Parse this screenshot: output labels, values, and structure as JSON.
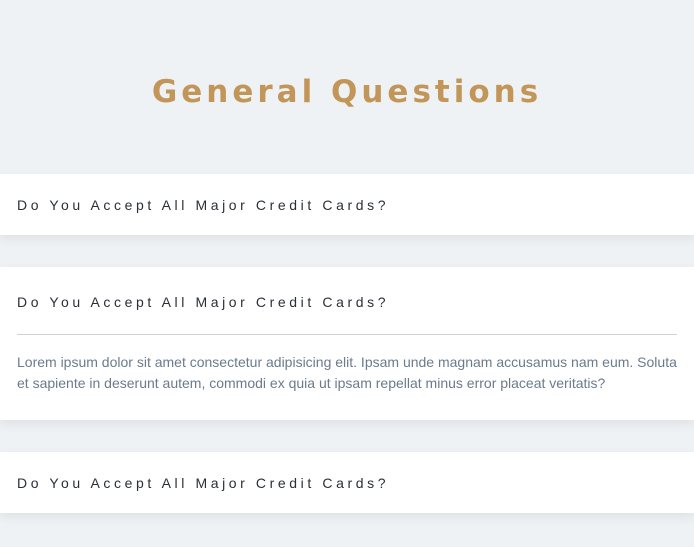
{
  "page": {
    "title": "General Questions"
  },
  "faq": {
    "items": [
      {
        "question": "Do You Accept All Major Credit Cards?",
        "open": false,
        "answer": ""
      },
      {
        "question": "Do You Accept All Major Credit Cards?",
        "open": true,
        "answer": "Lorem ipsum dolor sit amet consectetur adipisicing elit. Ipsam unde magnam accusamus nam eum. Soluta et sapiente in deserunt autem, commodi ex quia ut ipsam repellat minus error placeat veritatis?"
      },
      {
        "question": "Do You Accept All Major Credit Cards?",
        "open": false,
        "answer": ""
      }
    ]
  },
  "colors": {
    "background": "#eef2f5",
    "title": "#c29559",
    "question_text": "#2a2f38",
    "answer_text": "#6b7b8c",
    "card": "#ffffff"
  }
}
